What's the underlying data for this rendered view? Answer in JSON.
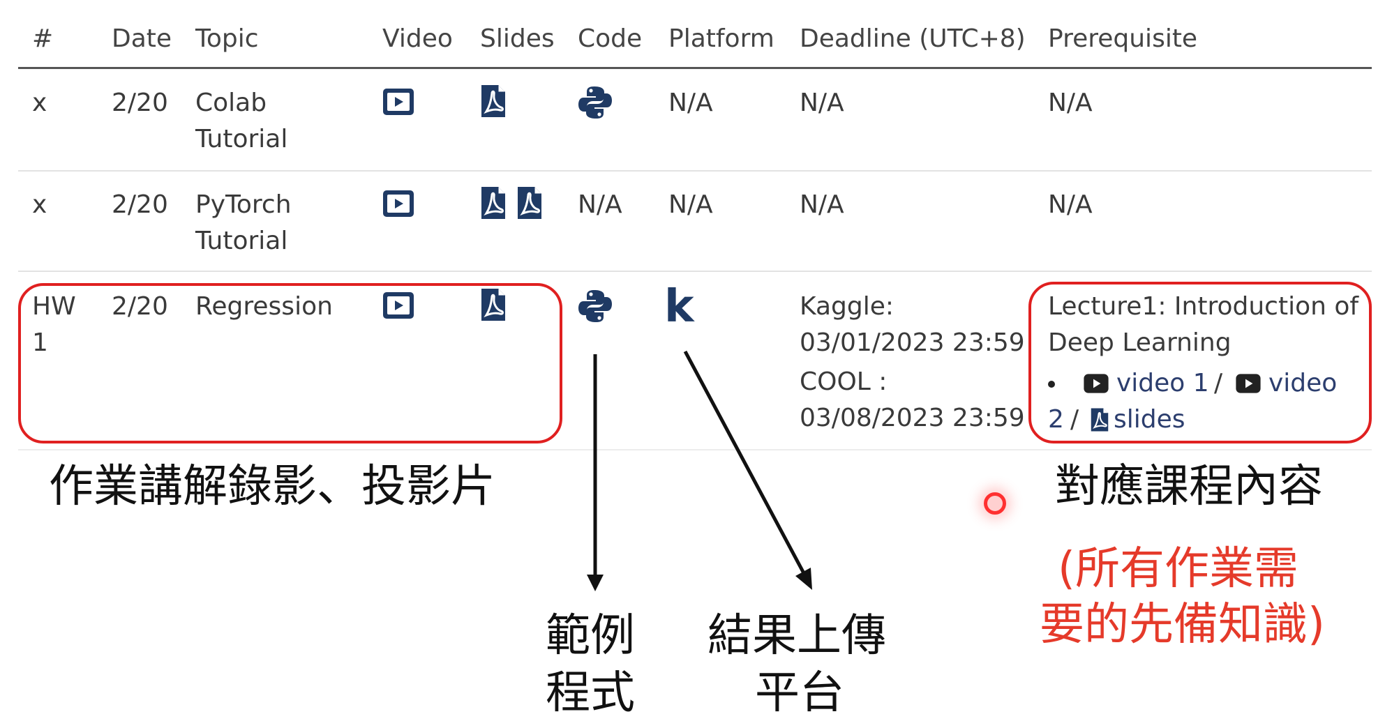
{
  "table": {
    "headers": {
      "num": "#",
      "date": "Date",
      "topic": "Topic",
      "video": "Video",
      "slides": "Slides",
      "code": "Code",
      "platform": "Platform",
      "deadline": "Deadline (UTC+8)",
      "prereq": "Prerequisite"
    },
    "rows": [
      {
        "num": "x",
        "date": "2/20",
        "topic_1": "Colab",
        "topic_2": "Tutorial",
        "platform": "N/A",
        "deadline": "N/A",
        "prereq": "N/A"
      },
      {
        "num": "x",
        "date": "2/20",
        "topic_1": "PyTorch",
        "topic_2": "Tutorial",
        "code": "N/A",
        "platform": "N/A",
        "deadline": "N/A",
        "prereq": "N/A"
      },
      {
        "num_1": "HW",
        "num_2": "1",
        "date": "2/20",
        "topic": "Regression",
        "platform_glyph": "k",
        "deadline_1": "Kaggle:",
        "deadline_2": "03/01/2023 23:59",
        "deadline_3": "COOL :",
        "deadline_4": "03/08/2023 23:59",
        "prereq_1": "Lecture1: Introduction of",
        "prereq_2": "Deep Learning",
        "prereq_video1": "video 1",
        "prereq_sep1": "/",
        "prereq_video2": "video",
        "prereq_video2b": "2",
        "prereq_sep2": "/",
        "prereq_slides": "slides"
      }
    ]
  },
  "annotations": {
    "hw_materials": "作業講解錄影、投影片",
    "code_1": "範例",
    "code_2": "程式",
    "platform_1": "結果上傳",
    "platform_2": "平台",
    "prereq": "對應課程內容",
    "prereq_note_1": "(所有作業需",
    "prereq_note_2": "要的先備知識)"
  },
  "icons": {
    "video": "youtube-icon",
    "slides": "pdf-icon",
    "code": "python-icon",
    "platform": "kaggle-icon"
  },
  "colors": {
    "icon_navy": "#1f3a64",
    "highlight_red": "#e02020",
    "note_red": "#e53a2a",
    "laser_dot": "#ff3030"
  }
}
